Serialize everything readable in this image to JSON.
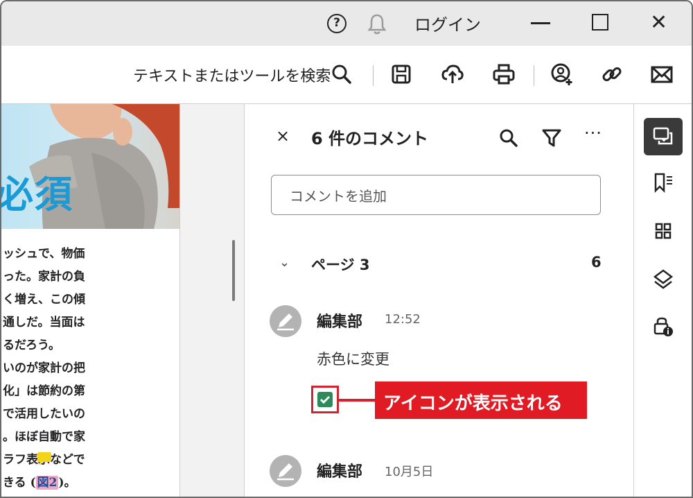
{
  "titlebar": {
    "login": "ログイン",
    "icons": [
      "help-icon",
      "bell-icon",
      "minimize-icon",
      "maximize-icon",
      "close-icon"
    ]
  },
  "toolbar": {
    "search_label": "テキストまたはツールを検索",
    "icons": [
      "search-icon",
      "save-icon",
      "upload-icon",
      "print-icon",
      "share-user-icon",
      "link-icon",
      "mail-icon"
    ]
  },
  "document": {
    "headline": "必須",
    "lines": [
      "ッシュで、物価",
      "った。家計の負",
      "く増え、この傾",
      "通しだ。当面は",
      "るだろう。",
      "いのが家計の把",
      "化」は節約の第",
      "で活用したいの",
      "。ほぼ自動で家",
      "ラフ表示などで"
    ],
    "last_line_prefix": "きる (",
    "figure_ref": "図2",
    "last_line_suffix": ")。"
  },
  "comments_panel": {
    "close": "×",
    "title": "6 件のコメント",
    "more": "···",
    "add_placeholder": "コメントを追加",
    "page_group": {
      "label": "ページ 3",
      "count": "6"
    },
    "comments": [
      {
        "author": "編集部",
        "time": "12:52",
        "text": "赤色に変更"
      },
      {
        "author": "編集部",
        "time": "10月5日"
      }
    ]
  },
  "annotation": {
    "callout_text": "アイコンが表示される",
    "color": "#e01b24"
  },
  "rail": {
    "icons": [
      "comments-icon",
      "bookmarks-icon",
      "thumbnails-icon",
      "layers-icon",
      "accessibility-icon"
    ]
  },
  "colors": {
    "accent_blue": "#1a9ad6",
    "check_green": "#2c8a5b",
    "highlight_pink": "#f1a7bf"
  }
}
